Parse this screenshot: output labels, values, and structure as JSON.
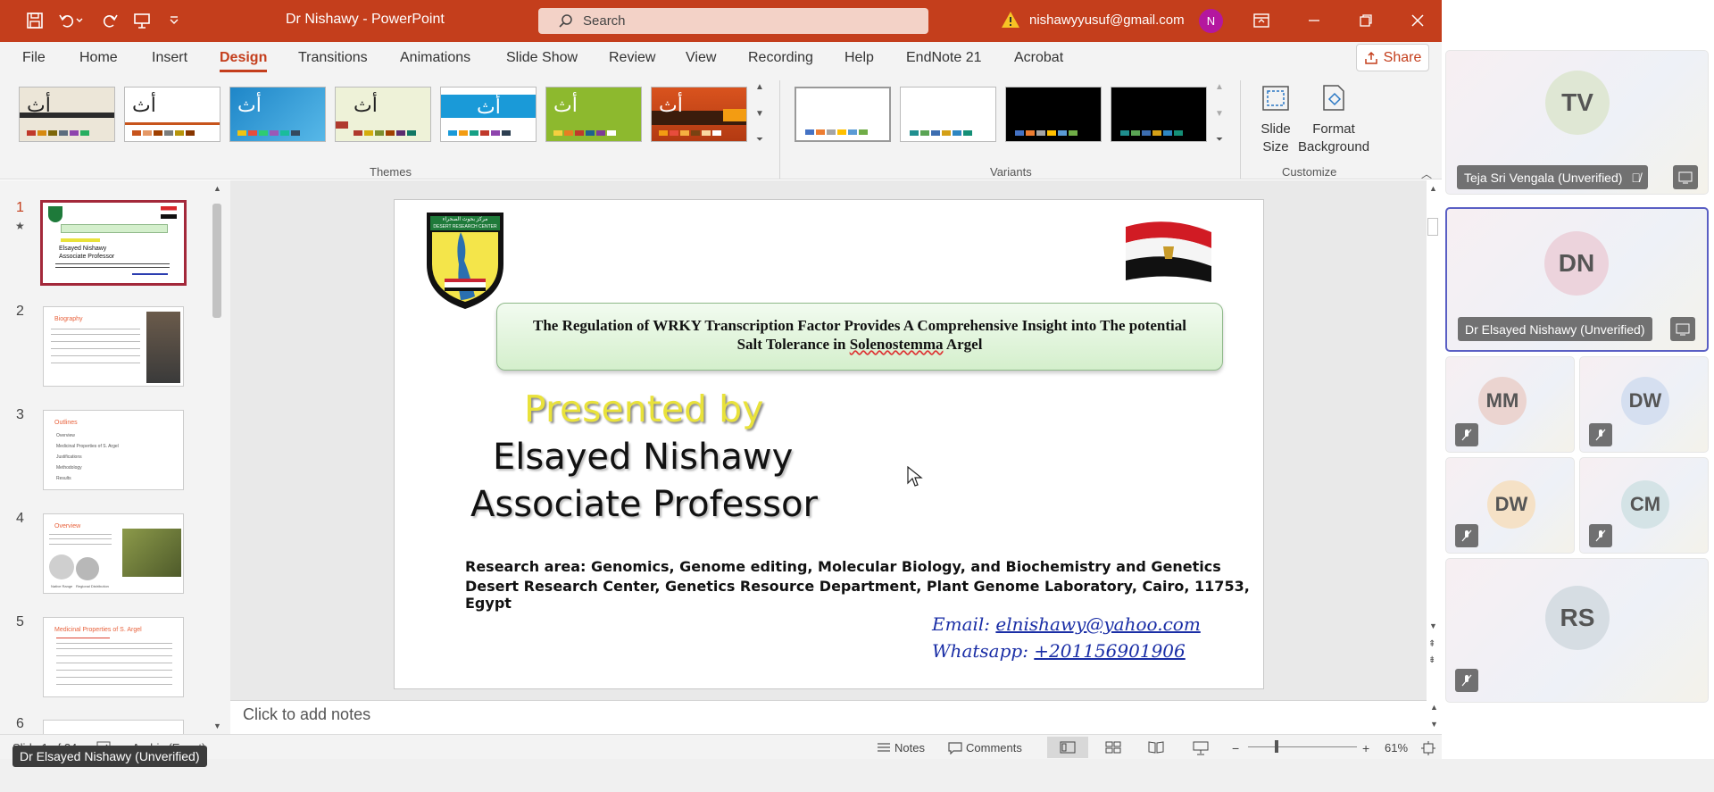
{
  "window": {
    "title": "Dr Nishawy  -  PowerPoint",
    "search_placeholder": "Search",
    "account_email": "nishawyyusuf@gmail.com",
    "account_initial": "N"
  },
  "menu": {
    "items": [
      "File",
      "Home",
      "Insert",
      "Design",
      "Transitions",
      "Animations",
      "Slide Show",
      "Review",
      "View",
      "Recording",
      "Help",
      "EndNote 21",
      "Acrobat"
    ],
    "active": "Design",
    "share_label": "Share"
  },
  "ribbon": {
    "themes_label": "Themes",
    "variants_label": "Variants",
    "customize_label": "Customize",
    "slide_size_label": "Slide Size",
    "format_background_label": "Format Background",
    "theme_glyph": "أث",
    "theme_colors": [
      "#e8e0d0",
      "#ffffff",
      "#2a8fd4",
      "#eef2d8",
      "#1a9ad8",
      "#8db92e",
      "#d9531e"
    ],
    "variant_colors": [
      "#ffffff",
      "#ffffff",
      "#000000",
      "#000000"
    ]
  },
  "thumbnails": {
    "slides": [
      {
        "num": "1",
        "title": ""
      },
      {
        "num": "2",
        "title": "Biography"
      },
      {
        "num": "3",
        "title": "Outlines"
      },
      {
        "num": "4",
        "title": "Overview"
      },
      {
        "num": "5",
        "title": "Medicinal Properties of S. Argel"
      },
      {
        "num": "6",
        "title": ""
      }
    ],
    "outline_items": [
      "Overview",
      "Medicinal Properties of S. Argel",
      "Justifications",
      "Methodology",
      "Results"
    ],
    "map_caption_1": "Native Range",
    "map_caption_2": "Regional Distribution"
  },
  "slide": {
    "title_line1": "The Regulation of WRKY Transcription Factor Provides A Comprehensive Insight into The potential",
    "title_line2_prefix": "Salt Tolerance in ",
    "title_line2_species": "Solenostemma",
    "title_line2_suffix": " Argel",
    "presented_by": "Presented by",
    "presenter_name": "Elsayed Nishawy",
    "presenter_title": "Associate Professor",
    "research_area": "Research area: Genomics, Genome editing, Molecular Biology, and Biochemistry and Genetics",
    "affiliation": "Desert Research Center, Genetics Resource Department, Plant Genome Laboratory, Cairo, 11753, Egypt",
    "email_label": "Email: ",
    "email_value": "elnishawy@yahoo.com",
    "whatsapp_label": "Whatsapp: ",
    "whatsapp_value": "+201156901906",
    "logo_text_arabic": "مركز بحوث الصحراء",
    "logo_text_english": "DESERT RESEARCH CENTER"
  },
  "notes": {
    "placeholder": "Click to add notes"
  },
  "status": {
    "slide_counter": "Slide 1 of 24",
    "language": "Arabic (Egypt)",
    "notes_label": "Notes",
    "comments_label": "Comments",
    "zoom": "61%"
  },
  "participants": {
    "tiles": [
      {
        "initials": "TV",
        "name": "Teja Sri Vengala (Unverified)"
      },
      {
        "initials": "DN",
        "name": "Dr Elsayed Nishawy (Unverified)"
      },
      {
        "initials": "MM",
        "name": ""
      },
      {
        "initials": "DW",
        "name": ""
      },
      {
        "initials": "DW",
        "name": ""
      },
      {
        "initials": "CM",
        "name": ""
      },
      {
        "initials": "RS",
        "name": ""
      }
    ],
    "tooltip": "Dr Elsayed Nishawy (Unverified)"
  }
}
